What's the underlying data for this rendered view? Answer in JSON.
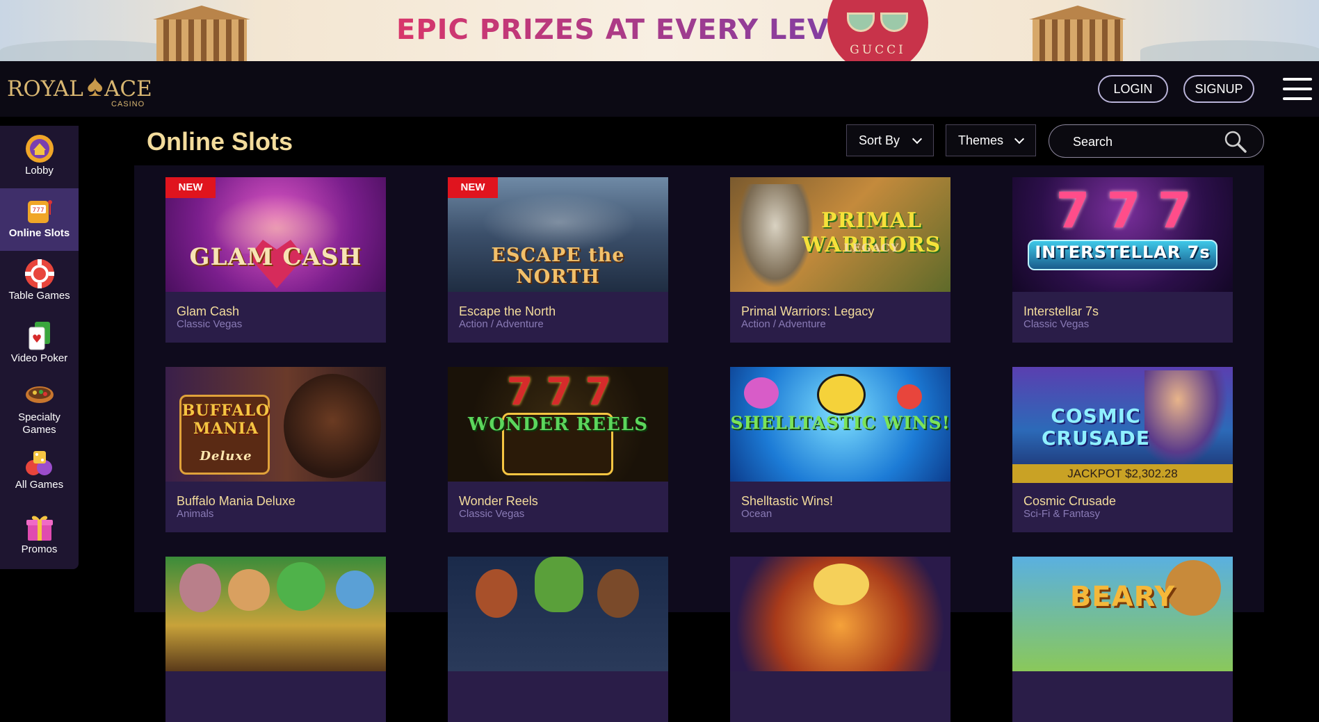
{
  "banner": {
    "headline": "EPIC PRIZES AT EVERY LEVEL",
    "brand": "GUCCI"
  },
  "header": {
    "logo": {
      "word1": "ROYAL",
      "word2": "ACE",
      "sub": "CASINO"
    },
    "login_label": "LOGIN",
    "signup_label": "SIGNUP"
  },
  "sidebar": {
    "items": [
      {
        "label": "Lobby",
        "icon": "lobby-icon",
        "active": false
      },
      {
        "label": "Online Slots",
        "icon": "slot-machine-icon",
        "active": true
      },
      {
        "label": "Table Games",
        "icon": "chip-icon",
        "active": false
      },
      {
        "label": "Video Poker",
        "icon": "cards-icon",
        "active": false
      },
      {
        "label": "Specialty Games",
        "icon": "bowl-icon",
        "active": false
      },
      {
        "label": "All Games",
        "icon": "dice-icon",
        "active": false
      },
      {
        "label": "Promos",
        "icon": "gift-icon",
        "active": false
      }
    ]
  },
  "main": {
    "title": "Online Slots",
    "sort_label": "Sort By",
    "themes_label": "Themes",
    "search_placeholder": "Search"
  },
  "games": [
    {
      "name": "Glam Cash",
      "category": "Classic Vegas",
      "badge": "NEW",
      "art_text": "GLAM CASH"
    },
    {
      "name": "Escape the North",
      "category": "Action / Adventure",
      "badge": "NEW",
      "art_text": "ESCAPE the NORTH"
    },
    {
      "name": "Primal Warriors: Legacy",
      "category": "Action / Adventure",
      "art_text": "PRIMAL WARRIORS",
      "art_sub": "LEGACY"
    },
    {
      "name": "Interstellar 7s",
      "category": "Classic Vegas",
      "art_text": "INTERSTELLAR 7s"
    },
    {
      "name": "Buffalo Mania Deluxe",
      "category": "Animals",
      "art_text": "BUFFALO MANIA",
      "art_sub": "Deluxe"
    },
    {
      "name": "Wonder Reels",
      "category": "Classic Vegas",
      "art_text": "WONDER REELS"
    },
    {
      "name": "Shelltastic Wins!",
      "category": "Ocean",
      "art_text": "SHELLTASTIC WINS!"
    },
    {
      "name": "Cosmic Crusade",
      "category": "Sci-Fi & Fantasy",
      "art_text": "COSMIC CRUSADE",
      "jackpot": "JACKPOT $2,302.28"
    },
    {
      "name": "",
      "category": ""
    },
    {
      "name": "",
      "category": ""
    },
    {
      "name": "",
      "category": ""
    },
    {
      "name": "",
      "category": "",
      "art_text": "BEARY"
    }
  ],
  "colors": {
    "accent_gold": "#f3dc9c",
    "card_bg": "#2a1d48",
    "sidebar_bg": "#1e1530",
    "sidebar_active": "#3f2f6a",
    "new_badge": "#e0141e",
    "jackpot_bar": "#c9a225"
  }
}
